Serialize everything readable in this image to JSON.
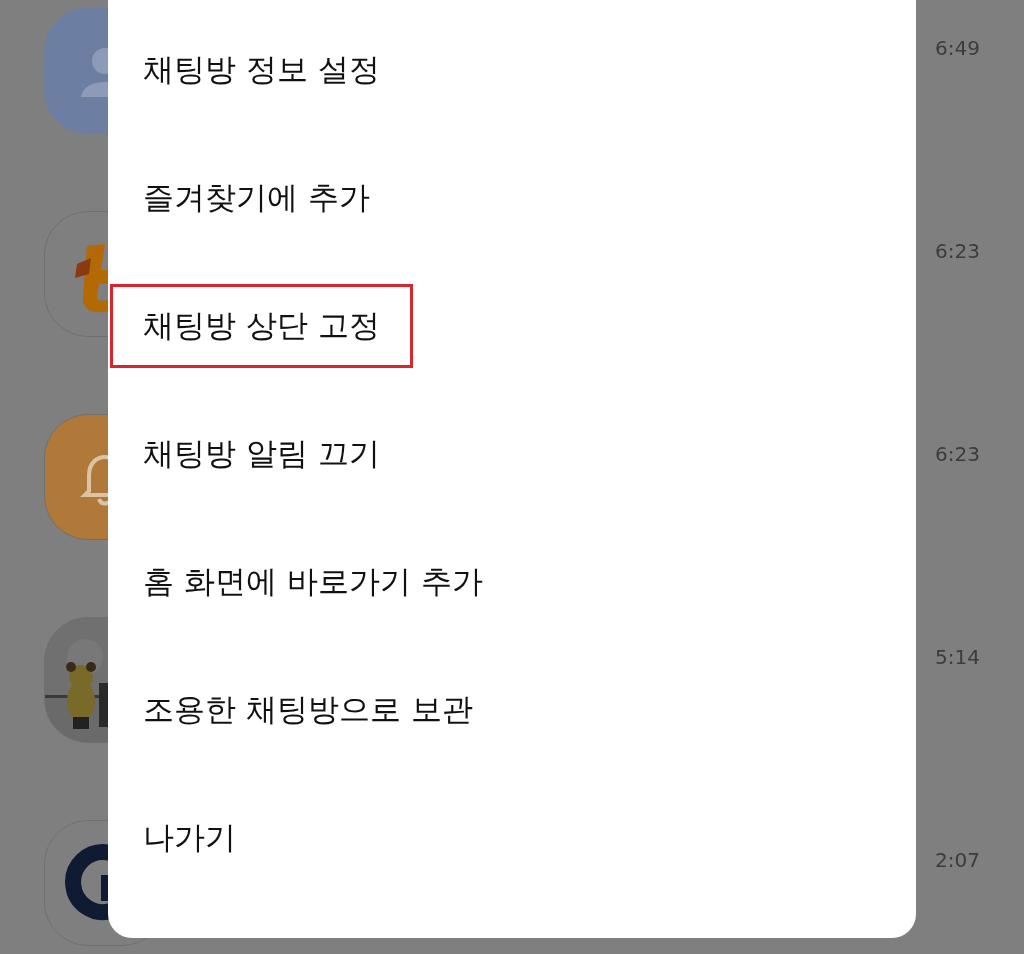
{
  "chats": [
    {
      "kind": "person",
      "time": "6:49"
    },
    {
      "kind": "logo",
      "time": "6:23"
    },
    {
      "kind": "bell",
      "time": "6:23"
    },
    {
      "kind": "picture",
      "time": "5:14"
    },
    {
      "kind": "emblem",
      "time": "2:07"
    }
  ],
  "menu": {
    "items": [
      {
        "label": "채팅방 정보 설정",
        "highlighted": false
      },
      {
        "label": "즐겨찾기에 추가",
        "highlighted": false
      },
      {
        "label": "채팅방 상단 고정",
        "highlighted": true
      },
      {
        "label": "채팅방 알림 끄기",
        "highlighted": false
      },
      {
        "label": "홈 화면에 바로가기 추가",
        "highlighted": false
      },
      {
        "label": "조용한 채팅방으로 보관",
        "highlighted": false
      },
      {
        "label": "나가기",
        "highlighted": false
      }
    ]
  }
}
